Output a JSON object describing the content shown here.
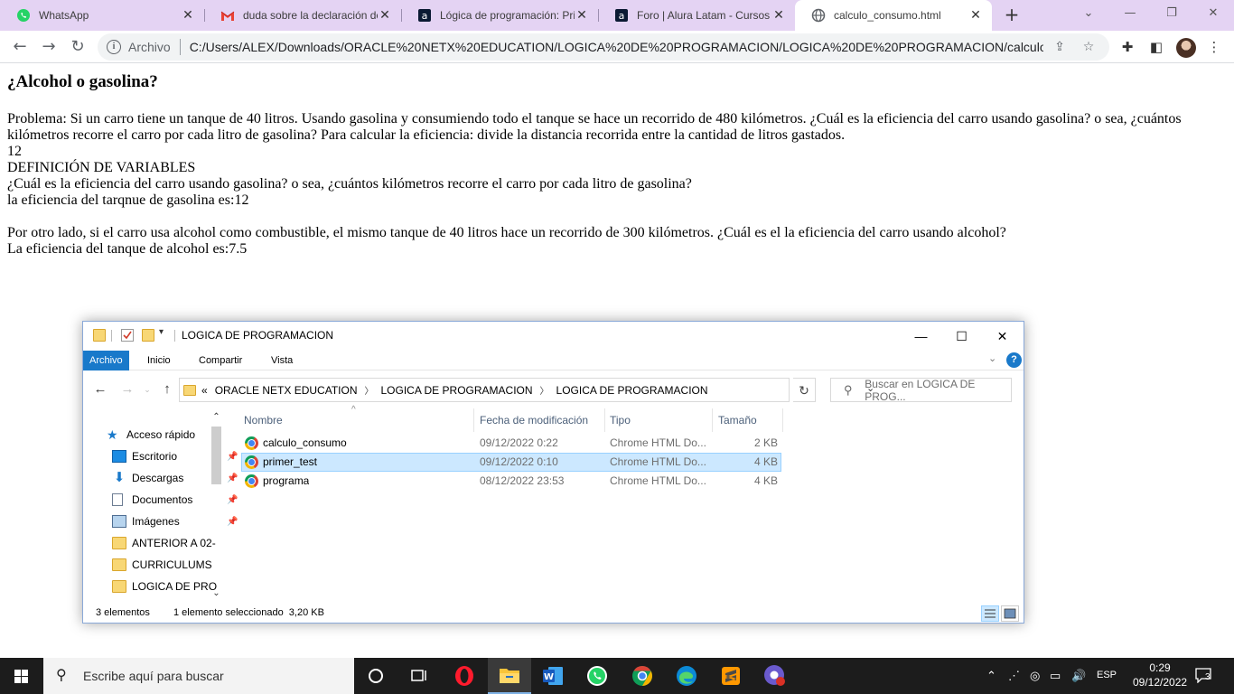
{
  "browser": {
    "tabs": [
      {
        "title": "WhatsApp",
        "icon": "whatsapp-icon"
      },
      {
        "title": "duda sobre la declaración de",
        "icon": "gmail-icon"
      },
      {
        "title": "Lógica de programación: Prin",
        "icon": "alura-icon"
      },
      {
        "title": "Foro | Alura Latam - Cursos c",
        "icon": "alura-icon"
      },
      {
        "title": "calculo_consumo.html",
        "icon": "globe-icon",
        "active": true
      }
    ],
    "address": {
      "scheme_label": "Archivo",
      "url": "C:/Users/ALEX/Downloads/ORACLE%20NETX%20EDUCATION/LOGICA%20DE%20PROGRAMACION/LOGICA%20DE%20PROGRAMACION/calculo_consu..."
    }
  },
  "page": {
    "heading": "¿Alcohol o gasolina?",
    "problem": "Problema: Si un carro tiene un tanque de 40 litros. Usando gasolina y consumiendo todo el tanque se hace un recorrido de 480 kilómetros. ¿Cuál es la eficiencia del carro usando gasolina? o sea, ¿cuántos kilómetros recorre el carro por cada litro de gasolina? Para calcular la eficiencia: divide la distancia recorrida entre la cantidad de litros gastados.",
    "value_12": "12",
    "definitions": "DEFINICIÓN DE VARIABLES",
    "question": "¿Cuál es la eficiencia del carro usando gasolina? o sea, ¿cuántos kilómetros recorre el carro por cada litro de gasolina?",
    "gas_result": "la eficiencia del tarqnue de gasolina es:12",
    "alcohol_problem": "Por otro lado, si el carro usa alcohol como combustible, el mismo tanque de 40 litros hace un recorrido de 300 kilómetros. ¿Cuál es el la eficiencia del carro usando alcohol?",
    "alcohol_result": "La eficiencia del tanque de alcohol es:7.5"
  },
  "explorer": {
    "title": "LOGICA DE PROGRAMACION",
    "ribbon_tabs": [
      "Archivo",
      "Inicio",
      "Compartir",
      "Vista"
    ],
    "breadcrumbs": [
      "ORACLE NETX EDUCATION",
      "LOGICA DE PROGRAMACION",
      "LOGICA DE PROGRAMACION"
    ],
    "breadcrumb_prefix": "«",
    "search_placeholder": "Buscar en LOGICA DE PROG...",
    "nav": {
      "quick_access": "Acceso rápido",
      "items": [
        "Escritorio",
        "Descargas",
        "Documentos",
        "Imágenes",
        "ANTERIOR A 02-",
        "CURRICULUMS",
        "LOGICA DE PRO"
      ]
    },
    "columns": [
      "Nombre",
      "Fecha de modificación",
      "Tipo",
      "Tamaño"
    ],
    "files": [
      {
        "name": "calculo_consumo",
        "date": "09/12/2022 0:22",
        "type": "Chrome HTML Do...",
        "size": "2 KB"
      },
      {
        "name": "primer_test",
        "date": "09/12/2022 0:10",
        "type": "Chrome HTML Do...",
        "size": "4 KB",
        "selected": true
      },
      {
        "name": "programa",
        "date": "08/12/2022 23:53",
        "type": "Chrome HTML Do...",
        "size": "4 KB"
      }
    ],
    "status": {
      "count": "3 elementos",
      "selection": "1 elemento seleccionado  3,20 KB"
    }
  },
  "taskbar": {
    "search_placeholder": "Escribe aquí para buscar",
    "language": "ESP",
    "time": "0:29",
    "date": "09/12/2022",
    "notifications": "3"
  }
}
